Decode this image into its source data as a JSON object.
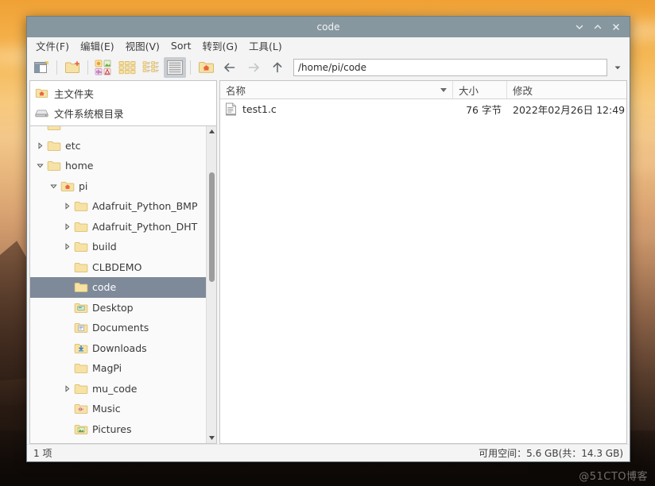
{
  "desktop": {
    "watermark": "@51CTO博客"
  },
  "window": {
    "title": "code",
    "controls": [
      {
        "name": "minimize",
        "glyph": "chevron-down-icon"
      },
      {
        "name": "maximize",
        "glyph": "chevron-up-icon"
      },
      {
        "name": "close",
        "glyph": "close-icon"
      }
    ]
  },
  "menubar": {
    "items": [
      {
        "label": "文件(F)",
        "name": "menu-file"
      },
      {
        "label": "编辑(E)",
        "name": "menu-edit"
      },
      {
        "label": "视图(V)",
        "name": "menu-view"
      },
      {
        "label": "Sort",
        "name": "menu-sort"
      },
      {
        "label": "转到(G)",
        "name": "menu-go"
      },
      {
        "label": "工具(L)",
        "name": "menu-tools"
      }
    ]
  },
  "toolbar": {
    "new_tab_tip": "new-window-icon",
    "new_folder_tip": "new-folder-icon",
    "icon_view_tip": "icon-view-icon",
    "thumbnail_view_tip": "thumbnail-view-icon",
    "compact_view_tip": "compact-view-icon",
    "detailed_view_tip": "detailed-list-view-icon",
    "home_tip": "home-folder-icon",
    "back_tip": "back-arrow-icon",
    "forward_tip": "forward-arrow-icon",
    "up_tip": "up-arrow-icon",
    "path": "/home/pi/code",
    "path_placeholder": "/home/pi/code",
    "dropdown_tip": "chevron-down-icon"
  },
  "places": {
    "items": [
      {
        "label": "主文件夹",
        "icon": "home-folder-icon",
        "name": "place-home"
      },
      {
        "label": "文件系统根目录",
        "icon": "drive-icon",
        "name": "place-filesystem-root"
      }
    ]
  },
  "tree": {
    "rows": [
      {
        "label": "",
        "indent": 1,
        "twisty": "none",
        "icon": "folder-icon",
        "selected": false,
        "partial": true
      },
      {
        "label": "etc",
        "indent": 1,
        "twisty": "collapsed",
        "icon": "folder-icon",
        "selected": false
      },
      {
        "label": "home",
        "indent": 1,
        "twisty": "expanded",
        "icon": "folder-icon",
        "selected": false
      },
      {
        "label": "pi",
        "indent": 2,
        "twisty": "expanded",
        "icon": "home-folder-icon",
        "selected": false
      },
      {
        "label": "Adafruit_Python_BMP",
        "indent": 3,
        "twisty": "collapsed",
        "icon": "folder-icon",
        "selected": false
      },
      {
        "label": "Adafruit_Python_DHT",
        "indent": 3,
        "twisty": "collapsed",
        "icon": "folder-icon",
        "selected": false
      },
      {
        "label": "build",
        "indent": 3,
        "twisty": "collapsed",
        "icon": "folder-icon",
        "selected": false
      },
      {
        "label": "CLBDEMO",
        "indent": 3,
        "twisty": "none",
        "icon": "folder-icon",
        "selected": false
      },
      {
        "label": "code",
        "indent": 3,
        "twisty": "none",
        "icon": "folder-icon",
        "selected": true
      },
      {
        "label": "Desktop",
        "indent": 3,
        "twisty": "none",
        "icon": "desktop-folder-icon",
        "selected": false
      },
      {
        "label": "Documents",
        "indent": 3,
        "twisty": "none",
        "icon": "documents-folder-icon",
        "selected": false
      },
      {
        "label": "Downloads",
        "indent": 3,
        "twisty": "none",
        "icon": "downloads-folder-icon",
        "selected": false
      },
      {
        "label": "MagPi",
        "indent": 3,
        "twisty": "none",
        "icon": "folder-icon",
        "selected": false
      },
      {
        "label": "mu_code",
        "indent": 3,
        "twisty": "collapsed",
        "icon": "folder-icon",
        "selected": false
      },
      {
        "label": "Music",
        "indent": 3,
        "twisty": "none",
        "icon": "music-folder-icon",
        "selected": false
      },
      {
        "label": "Pictures",
        "indent": 3,
        "twisty": "none",
        "icon": "pictures-folder-icon",
        "selected": false
      },
      {
        "label": "",
        "indent": 3,
        "twisty": "none",
        "icon": "folder-icon",
        "selected": false,
        "partial": true
      }
    ],
    "scrollbar": {
      "thumb_top_pct": 12,
      "thumb_height_pct": 37
    }
  },
  "filelist": {
    "columns": [
      {
        "label": "名称",
        "name": "column-name",
        "sorted": true
      },
      {
        "label": "大小",
        "name": "column-size",
        "sorted": false
      },
      {
        "label": "修改",
        "name": "column-modified",
        "sorted": false
      }
    ],
    "rows": [
      {
        "name": "test1.c",
        "size": "76 字节",
        "modified": "2022年02月26日 12:49",
        "icon": "text-file-icon"
      }
    ]
  },
  "statusbar": {
    "left": "1 项",
    "right": "可用空间：5.6 GB(共：14.3 GB)"
  },
  "colors": {
    "titlebar": "#87979f",
    "selection": "#7e8a99",
    "folder": "#f5d98f",
    "window_bg": "#f4f4f4"
  }
}
